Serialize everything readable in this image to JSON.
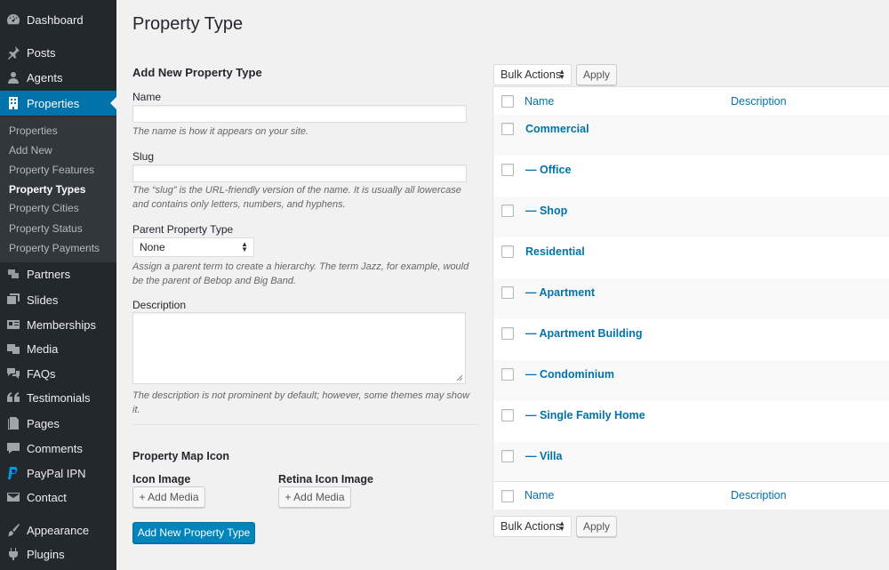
{
  "sidebar": {
    "items": [
      {
        "label": "Dashboard",
        "icon": "dashboard-icon"
      },
      {
        "label": "Posts",
        "icon": "pin-icon"
      },
      {
        "label": "Agents",
        "icon": "user-icon"
      },
      {
        "label": "Properties",
        "icon": "building-icon"
      },
      {
        "label": "Partners",
        "icon": "partners-icon"
      },
      {
        "label": "Slides",
        "icon": "slides-icon"
      },
      {
        "label": "Memberships",
        "icon": "id-card-icon"
      },
      {
        "label": "Media",
        "icon": "media-icon"
      },
      {
        "label": "FAQs",
        "icon": "comments-icon"
      },
      {
        "label": "Testimonials",
        "icon": "quote-icon"
      },
      {
        "label": "Pages",
        "icon": "pages-icon"
      },
      {
        "label": "Comments",
        "icon": "comment-icon"
      },
      {
        "label": "PayPal IPN",
        "icon": "paypal-icon"
      },
      {
        "label": "Contact",
        "icon": "mail-icon"
      },
      {
        "label": "Appearance",
        "icon": "brush-icon"
      },
      {
        "label": "Plugins",
        "icon": "plug-icon"
      }
    ],
    "submenu": [
      "Properties",
      "Add New",
      "Property Features",
      "Property Types",
      "Property Cities",
      "Property Status",
      "Property Payments"
    ],
    "current_submenu": "Property Types",
    "active_color": "#0073aa"
  },
  "page": {
    "title": "Property Type"
  },
  "form": {
    "heading": "Add New Property Type",
    "name_label": "Name",
    "name_value": "",
    "name_help": "The name is how it appears on your site.",
    "slug_label": "Slug",
    "slug_value": "",
    "slug_help_1": "The “slug” is the URL-friendly version of the name. It is usually all lowercase",
    "slug_help_2": "and contains only letters, numbers, and hyphens.",
    "parent_label": "Parent Property Type",
    "parent_selected": "None",
    "parent_help_1": "Assign a parent term to create a hierarchy. The term Jazz, for example, would",
    "parent_help_2": "be the parent of Bebop and Big Band.",
    "description_label": "Description",
    "description_value": "",
    "description_help_1": "The description is not prominent by default; however, some themes may show",
    "description_help_2": "it.",
    "map_icon_heading": "Property Map Icon",
    "icon_image_label": "Icon Image",
    "retina_icon_label": "Retina Icon Image",
    "add_media_label": "+ Add Media",
    "submit_label": "Add New Property Type"
  },
  "table": {
    "bulk_actions": "Bulk Actions",
    "apply_label": "Apply",
    "col_name": "Name",
    "col_description": "Description",
    "rows": [
      "Commercial",
      "— Office",
      "— Shop",
      "Residential",
      "— Apartment",
      "— Apartment Building",
      "— Condominium",
      "— Single Family Home",
      "— Villa"
    ]
  }
}
